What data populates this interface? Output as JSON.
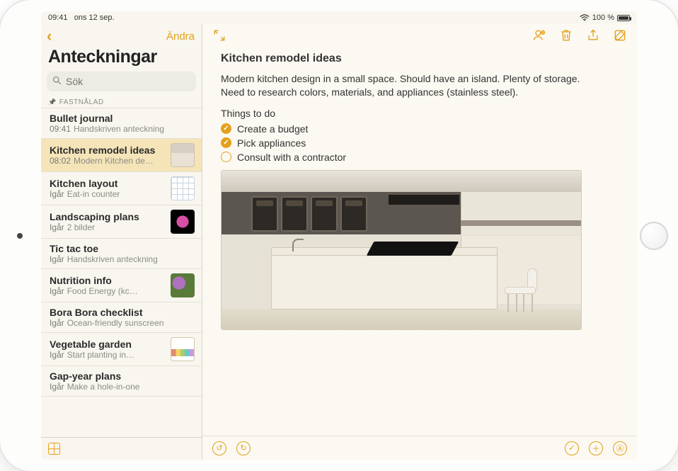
{
  "status": {
    "time": "09:41",
    "date": "ons 12 sep.",
    "battery_pct": "100 %",
    "wifi": true
  },
  "sidebar": {
    "back_label": "Back",
    "edit_label": "Ändra",
    "title": "Anteckningar",
    "search_placeholder": "Sök",
    "pinned_label": "FASTNÅLAD",
    "notes": [
      {
        "title": "Bullet journal",
        "time": "09:41",
        "preview": "Handskriven anteckning",
        "thumb": null,
        "selected": false
      },
      {
        "title": "Kitchen remodel ideas",
        "time": "08:02",
        "preview": "Modern Kitchen de…",
        "thumb": "kitchen",
        "selected": true
      },
      {
        "title": "Kitchen layout",
        "time": "Igår",
        "preview": "Eat-in counter",
        "thumb": "layout",
        "selected": false
      },
      {
        "title": "Landscaping plans",
        "time": "Igår",
        "preview": "2 bilder",
        "thumb": "flower",
        "selected": false
      },
      {
        "title": "Tic tac toe",
        "time": "Igår",
        "preview": "Handskriven anteckning",
        "thumb": null,
        "selected": false
      },
      {
        "title": "Nutrition info",
        "time": "Igår",
        "preview": "Food Energy (kc…",
        "thumb": "veggies",
        "selected": false
      },
      {
        "title": "Bora Bora checklist",
        "time": "Igår",
        "preview": "Ocean-friendly sunscreen",
        "thumb": null,
        "selected": false
      },
      {
        "title": "Vegetable garden",
        "time": "Igår",
        "preview": "Start planting in…",
        "thumb": "garden",
        "selected": false
      },
      {
        "title": "Gap-year plans",
        "time": "Igår",
        "preview": "Make a hole-in-one",
        "thumb": null,
        "selected": false
      }
    ]
  },
  "note": {
    "title": "Kitchen remodel ideas",
    "description": "Modern kitchen design in a small space. Should have an island. Plenty of storage. Need to research colors, materials, and appliances (stainless steel).",
    "section": "Things to do",
    "checklist": [
      {
        "text": "Create a budget",
        "done": true
      },
      {
        "text": "Pick appliances",
        "done": true
      },
      {
        "text": "Consult with a contractor",
        "done": false
      }
    ]
  },
  "toolbar": {
    "fullscreen": "Full screen",
    "add_person": "Add collaborator",
    "delete": "Delete",
    "share": "Share",
    "compose": "New note"
  },
  "bottom": {
    "undo": "Undo",
    "redo": "Redo",
    "checklist": "Checklist",
    "add": "Add",
    "markup": "Markup"
  }
}
